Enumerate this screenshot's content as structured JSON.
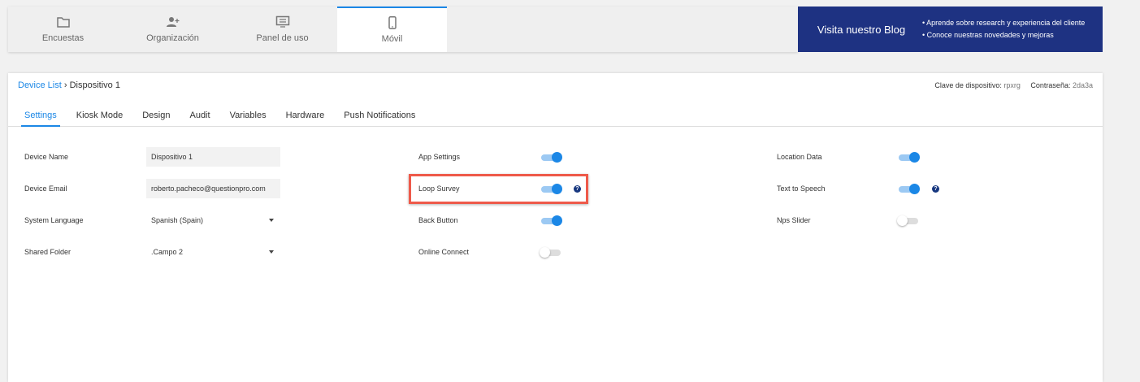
{
  "topnav": [
    {
      "label": "Encuestas",
      "icon": "folder-icon"
    },
    {
      "label": "Organización",
      "icon": "add-user-icon"
    },
    {
      "label": "Panel de uso",
      "icon": "monitor-icon"
    },
    {
      "label": "Móvil",
      "icon": "mobile-icon",
      "active": true
    }
  ],
  "blog": {
    "title": "Visita nuestro Blog",
    "bullets": [
      "Aprende sobre research y experiencia del cliente",
      "Conoce nuestras novedades y mejoras"
    ]
  },
  "breadcrumb": {
    "link": "Device List",
    "current": "Dispositivo 1"
  },
  "meta": {
    "key_label": "Clave de dispositivo:",
    "key": "rpxrg",
    "pass_label": "Contraseña:",
    "pass": "2da3a"
  },
  "tabs": [
    "Settings",
    "Kiosk Mode",
    "Design",
    "Audit",
    "Variables",
    "Hardware",
    "Push Notifications"
  ],
  "fields": {
    "device_name": {
      "label": "Device Name",
      "value": "Dispositivo 1"
    },
    "device_email": {
      "label": "Device Email",
      "value": "roberto.pacheco@questionpro.com"
    },
    "language": {
      "label": "System Language",
      "value": "Spanish (Spain)"
    },
    "folder": {
      "label": "Shared Folder",
      "value": ".Campo 2"
    }
  },
  "toggles": {
    "app_settings": {
      "label": "App Settings",
      "on": true
    },
    "loop_survey": {
      "label": "Loop Survey",
      "on": true
    },
    "back_button": {
      "label": "Back Button",
      "on": true
    },
    "online_connect": {
      "label": "Online Connect",
      "on": false
    },
    "location_data": {
      "label": "Location Data",
      "on": true
    },
    "tts": {
      "label": "Text to Speech",
      "on": true
    },
    "nps": {
      "label": "Nps Slider",
      "on": false
    }
  },
  "help_glyph": "?"
}
